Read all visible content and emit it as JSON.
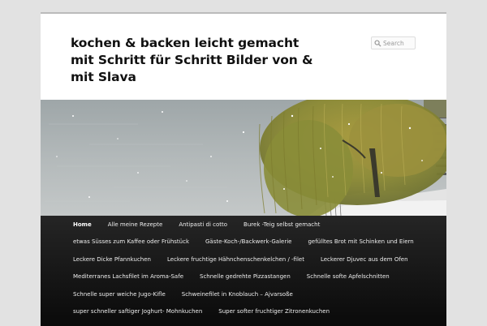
{
  "site": {
    "title": "kochen & backen leicht gemacht mit Schritt für Schritt Bilder von & mit Slava"
  },
  "search": {
    "placeholder": "Search",
    "icon": "search-icon"
  },
  "colors": {
    "background": "#e2e2e2",
    "nav_background": "#1a1a1a",
    "nav_text": "#eeeeee"
  },
  "nav": {
    "items": [
      "Home",
      "Alle meine Rezepte",
      "Antipasti di cotto",
      "Burek -Teig selbst gemacht",
      "etwas Süsses zum Kaffee oder Frühstück",
      "Gäste-Koch-/Backwerk-Galerie",
      "gefülltes Brot mit Schinken und Eiern",
      "Leckere Dicke Pfannkuchen",
      "Leckere fruchtige Hähnchenschenkelchen / -filet",
      "Leckerer Djuvec aus dem Ofen",
      "Mediterranes Lachsfilet im Aroma-Safe",
      "Schnelle gedrehte Pizzastangen",
      "Schnelle softe Apfelschnitten",
      "Schnelle super weiche Jugo-Kifle",
      "Schweinefilet in Knoblauch – Ajvarsoße",
      "super schneller saftiger Joghurt- Mohnkuchen",
      "Super softer fruchtiger Zitronenkuchen"
    ],
    "current": "Home"
  }
}
